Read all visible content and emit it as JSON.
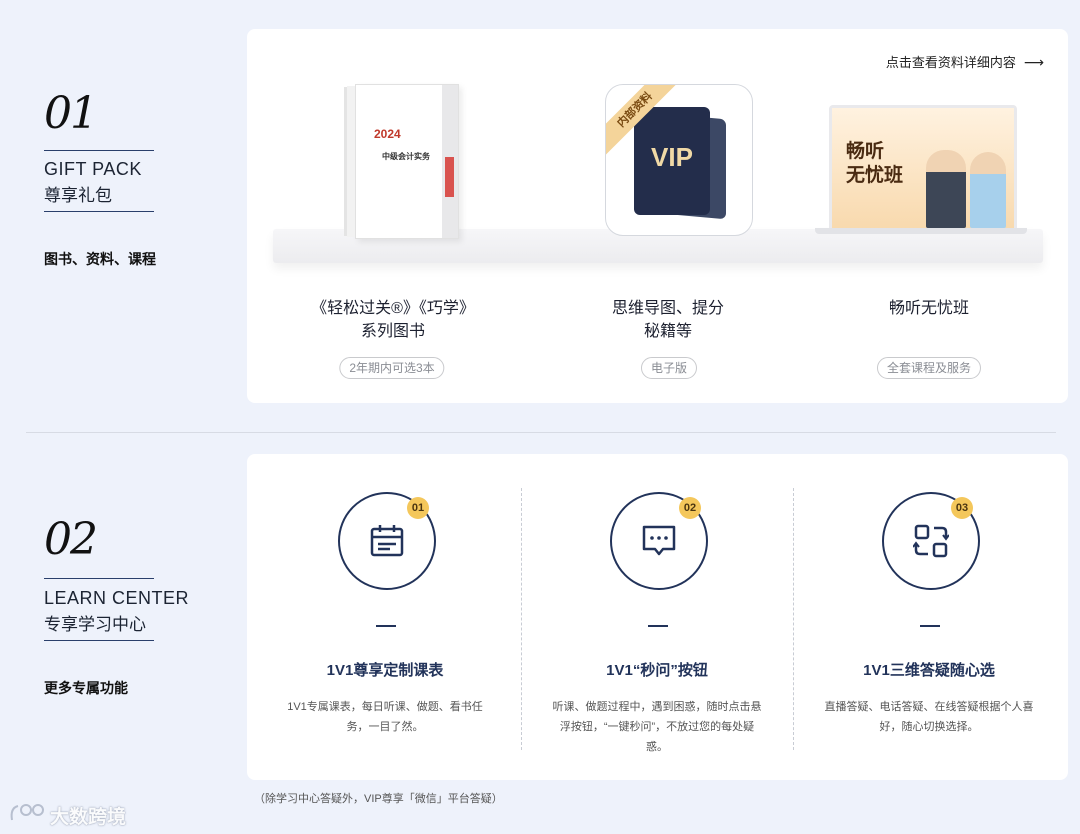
{
  "section1": {
    "num": "01",
    "en": "GIFT PACK",
    "cn": "尊享礼包",
    "sub": "图书、资料、课程",
    "detail_link": "点击查看资料详细内容",
    "items": [
      {
        "title_line1": "《轻松过关®》《巧学》",
        "title_line2": "系列图书",
        "badge": "2年期内可选3本",
        "book_year": "2024",
        "book_title": "中级会计实务"
      },
      {
        "title_line1": "思维导图、提分",
        "title_line2": "秘籍等",
        "badge": "电子版",
        "ribbon": "内部资料",
        "vip": "VIP"
      },
      {
        "title_line1": "畅听无忧班",
        "title_line2": "",
        "badge": "全套课程及服务",
        "screen_title_1": "畅听",
        "screen_title_2": "无忧班"
      }
    ]
  },
  "section2": {
    "num": "02",
    "en": "LEARN CENTER",
    "cn": "专享学习中心",
    "sub": "更多专属功能",
    "features": [
      {
        "num": "01",
        "icon": "calendar-icon",
        "title": "1V1尊享定制课表",
        "desc": "1V1专属课表，每日听课、做题、看书任务，一目了然。"
      },
      {
        "num": "02",
        "icon": "chat-bubble-icon",
        "title": "1V1“秒问”按钮",
        "desc": "听课、做题过程中，遇到困惑，随时点击悬浮按钮，“一键秒问”，不放过您的每处疑惑。"
      },
      {
        "num": "03",
        "icon": "switch-icon",
        "title": "1V1三维答疑随心选",
        "desc": "直播答疑、电话答疑、在线答疑根据个人喜好，随心切换选择。"
      }
    ],
    "footnote": "（除学习中心答疑外，VIP尊享「微信」平台答疑）"
  },
  "watermark": "大数跨境",
  "colors": {
    "page_bg": "#eef2fb",
    "navy": "#22335a",
    "badge_gold": "#f4c75b"
  }
}
